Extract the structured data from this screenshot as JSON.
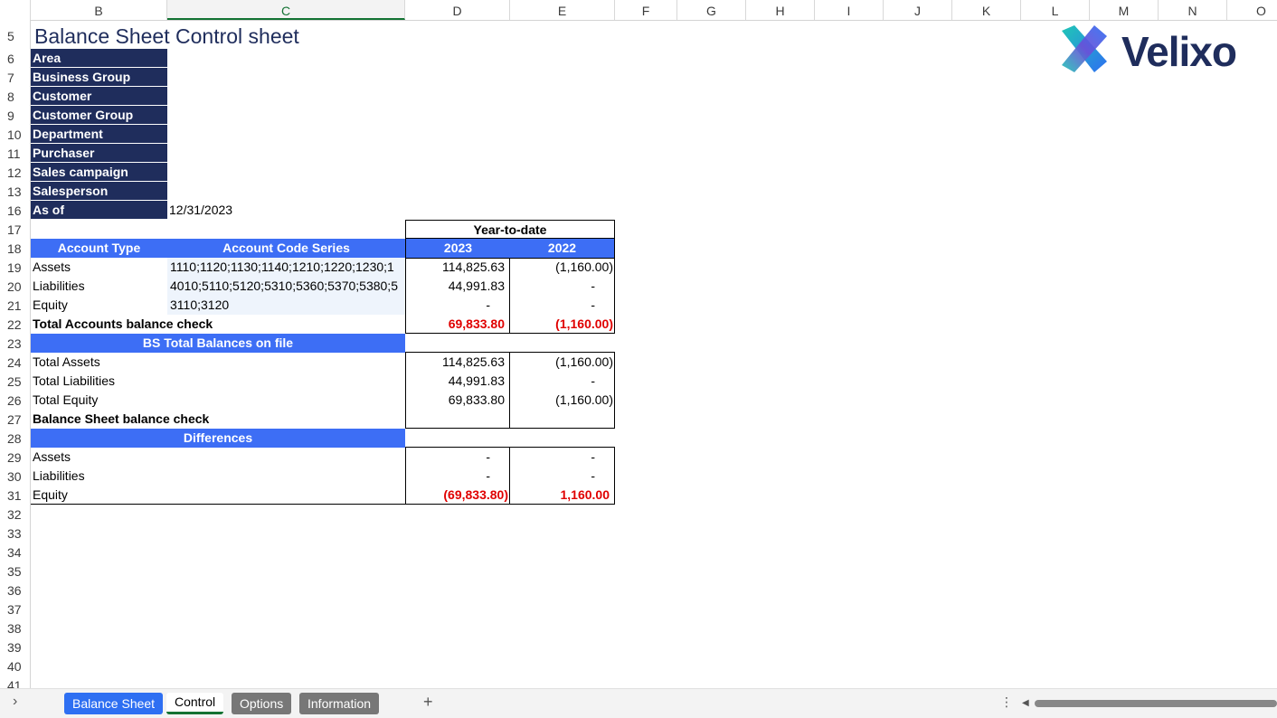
{
  "columns": [
    "B",
    "C",
    "D",
    "E",
    "F",
    "G",
    "H",
    "I",
    "J",
    "K",
    "L",
    "M",
    "N",
    "O"
  ],
  "rows": [
    "5",
    "6",
    "7",
    "8",
    "9",
    "10",
    "11",
    "12",
    "13",
    "16",
    "17",
    "18",
    "19",
    "20",
    "21",
    "22",
    "23",
    "24",
    "25",
    "26",
    "27",
    "28",
    "29",
    "30",
    "31",
    "32",
    "33",
    "34",
    "35",
    "36",
    "37",
    "38",
    "39",
    "40",
    "41"
  ],
  "sheet": {
    "title": "Balance Sheet Control sheet",
    "filters": [
      "Area",
      "Business Group",
      "Customer",
      "Customer Group",
      "Department",
      "Purchaser",
      "Sales campaign",
      "Salesperson",
      "As of"
    ],
    "as_of_value": "12/31/2023",
    "ytd_header": "Year-to-date",
    "account_type_header": "Account Type",
    "code_series_header": "Account Code Series",
    "year1": "2023",
    "year2": "2022",
    "accounts": [
      {
        "type": "Assets",
        "codes": "1110;1120;1130;1140;1210;1220;1230;1",
        "v1": "114,825.63",
        "v2": "(1,160.00)"
      },
      {
        "type": "Liabilities",
        "codes": "4010;5110;5120;5310;5360;5370;5380;5",
        "v1": "44,991.83",
        "v2": "-"
      },
      {
        "type": "Equity",
        "codes": "3110;3120",
        "v1": "-",
        "v2": "-"
      }
    ],
    "total_check_label": "Total Accounts balance check",
    "total_check_v1": "69,833.80",
    "total_check_v2": "(1,160.00)",
    "bs_header": "BS Total Balances on file",
    "bs_rows": [
      {
        "label": "Total Assets",
        "v1": "114,825.63",
        "v2": "(1,160.00)"
      },
      {
        "label": "Total Liabilities",
        "v1": "44,991.83",
        "v2": "-"
      },
      {
        "label": "Total Equity",
        "v1": "69,833.80",
        "v2": "(1,160.00)"
      }
    ],
    "bs_check_label": "Balance Sheet balance check",
    "diff_header": "Differences",
    "diff_rows": [
      {
        "label": "Assets",
        "v1": "-",
        "v2": "-"
      },
      {
        "label": "Liabilities",
        "v1": "-",
        "v2": "-"
      },
      {
        "label": "Equity",
        "v1": "(69,833.80)",
        "v2": "1,160.00"
      }
    ]
  },
  "logo": {
    "text": "Velixo",
    "icon": "velixo-x-logo-icon",
    "colors": [
      "#2e6ff2",
      "#1fc7b6",
      "#1f2d5c"
    ]
  },
  "tabs": {
    "nav_icon": "chevron-right-icon",
    "items": [
      "Balance Sheet",
      "Control",
      "Options",
      "Information"
    ],
    "add_icon": "plus-icon",
    "more_icon": "vertical-ellipsis-icon"
  },
  "colors": {
    "navy": "#1f2d5c",
    "header_blue": "#3d6ef5",
    "red": "#e00000",
    "active_tab_underline": "#137333"
  }
}
